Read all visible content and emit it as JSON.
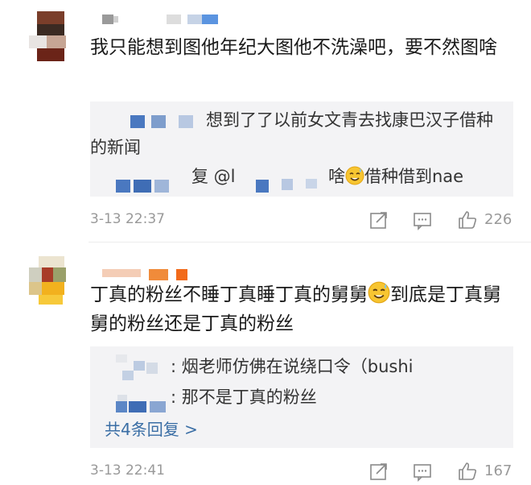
{
  "comments": [
    {
      "text": "我只能想到图他年纪大图他不洗澡吧，要不然图啥",
      "replies": [
        {
          "text": "想到了了以前女文青去找康巴汉子借种的新闻"
        },
        {
          "prefix": "复 @l",
          "text": "啥",
          "text_after_emoji": "借种借到nae"
        }
      ],
      "timestamp": "3-13 22:37",
      "like_count": "226"
    },
    {
      "text": "丁真的粉丝不睡丁真睡丁真的舅舅",
      "text_after_emoji": "到底是丁真舅舅的粉丝还是丁真的粉丝",
      "replies": [
        {
          "text": ": 烟老师仿佛在说绕口令（bushi"
        },
        {
          "text": ": 那不是丁真的粉丝"
        }
      ],
      "more_replies_label": "共4条回复 >",
      "timestamp": "3-13 22:41",
      "like_count": "167"
    }
  ],
  "icons": {
    "share": "share-icon",
    "comment": "comment-icon",
    "like": "thumbs-up-icon",
    "emoji": "sweat-smile-emoji-icon"
  },
  "colors": {
    "reply_background": "#f3f3f5",
    "meta_text": "#999999",
    "link": "#3a6ea5"
  }
}
